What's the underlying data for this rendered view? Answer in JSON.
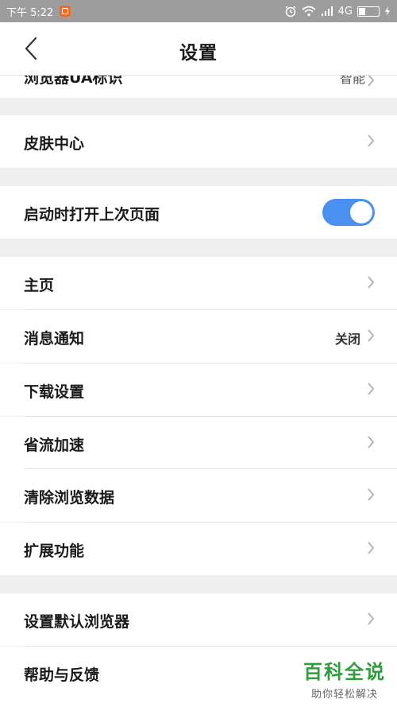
{
  "status_bar": {
    "time": "下午 5:22",
    "network": "4G",
    "battery_level": 0.35
  },
  "header": {
    "title": "设置"
  },
  "partial_item": {
    "label": "浏览器UA标识",
    "value": "智能"
  },
  "sections": {
    "skin": {
      "label": "皮肤中心"
    },
    "startup": {
      "label": "启动时打开上次页面",
      "toggle_on": true
    },
    "homepage": {
      "label": "主页"
    },
    "notification": {
      "label": "消息通知",
      "value": "关闭"
    },
    "download": {
      "label": "下载设置"
    },
    "traffic": {
      "label": "省流加速"
    },
    "clear": {
      "label": "清除浏览数据"
    },
    "extensions": {
      "label": "扩展功能"
    },
    "default_browser": {
      "label": "设置默认浏览器"
    },
    "feedback": {
      "label": "帮助与反馈"
    }
  },
  "watermark": {
    "title": "百科全说",
    "subtitle": "助你轻松解决"
  },
  "colors": {
    "accent": "#4a90f0",
    "watermark_green": "#2e9e3c"
  }
}
